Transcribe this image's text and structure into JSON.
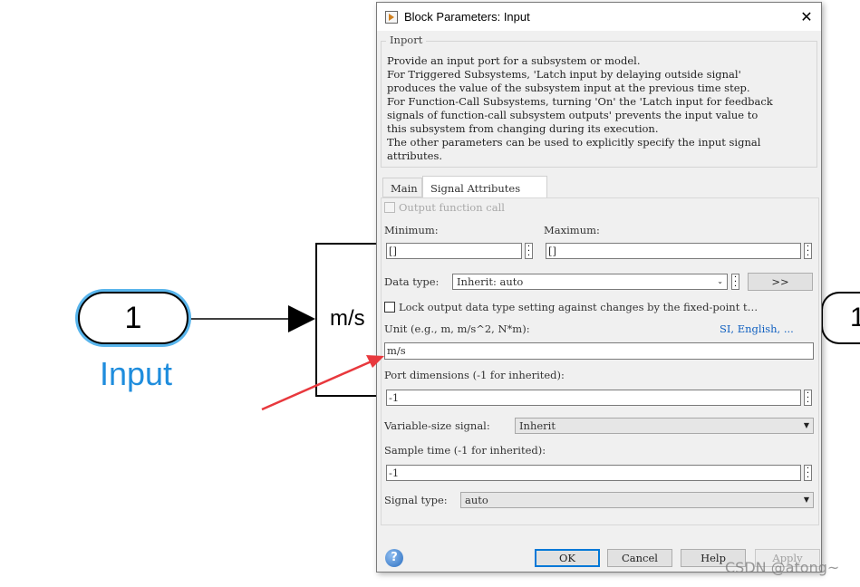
{
  "canvas": {
    "inport_number": "1",
    "inport_label": "Input",
    "subsystem_label": "m/s",
    "right_block_number": "1",
    "arrow_color": "#e8383d",
    "signal_color": "#000000",
    "label_color": "#1f8ddd"
  },
  "dialog": {
    "title": "Block Parameters: Input",
    "group_title": "Inport",
    "description": [
      "Provide an input port for a subsystem or model.",
      "For Triggered Subsystems, 'Latch input by delaying outside signal'",
      "produces the value of the subsystem input at the previous time step.",
      "For Function-Call Subsystems, turning 'On' the 'Latch input for feedback",
      "signals of function-call subsystem outputs' prevents the input value to",
      "this subsystem from changing during its execution.",
      "The other parameters can be used to explicitly specify the input signal",
      "attributes."
    ],
    "tabs": [
      {
        "label": "Main",
        "active": false
      },
      {
        "label": "Signal Attributes",
        "active": true
      }
    ],
    "signal_attributes": {
      "output_function_call_label": "Output function call",
      "minimum_label": "Minimum:",
      "minimum_value": "[]",
      "maximum_label": "Maximum:",
      "maximum_value": "[]",
      "data_type_label": "Data type:",
      "data_type_value": "Inherit: auto",
      "data_type_assistant": ">>",
      "lock_label": "Lock output data type setting against changes by the fixed-point t…",
      "unit_label": "Unit (e.g., m, m/s^2, N*m):",
      "unit_link": "SI, English, ...",
      "unit_value": "m/s",
      "port_dimensions_label": "Port dimensions (-1 for inherited):",
      "port_dimensions_value": "-1",
      "variable_size_label": "Variable-size signal:",
      "variable_size_value": "Inherit",
      "sample_time_label": "Sample time (-1 for inherited):",
      "sample_time_value": "-1",
      "signal_type_label": "Signal type:",
      "signal_type_value": "auto"
    },
    "buttons": {
      "ok": "OK",
      "cancel": "Cancel",
      "help": "Help",
      "apply": "Apply"
    }
  },
  "watermark": "CSDN @atong~"
}
